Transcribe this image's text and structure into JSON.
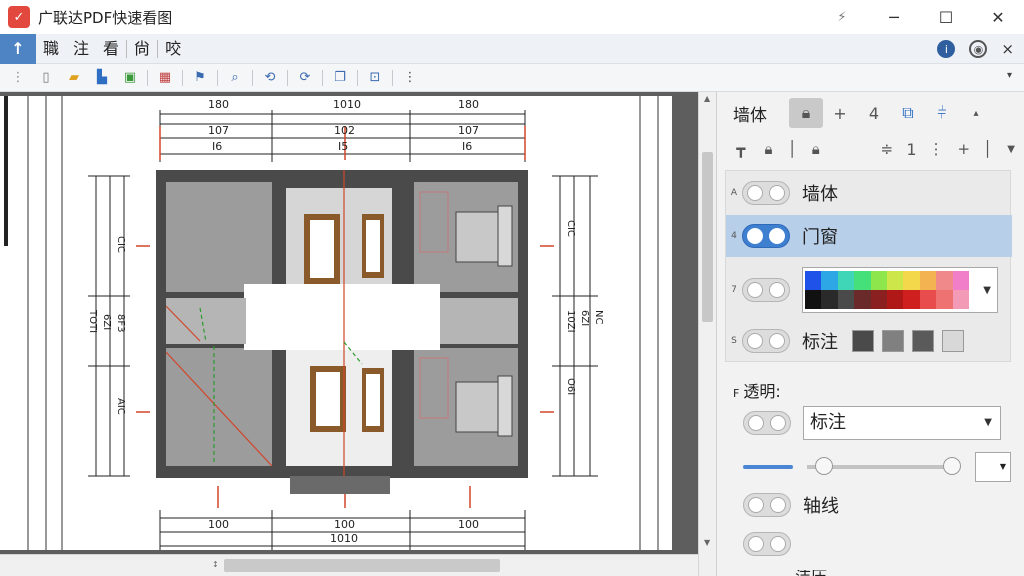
{
  "app": {
    "title": "广联达PDF快速看图",
    "logo_glyph": "✓"
  },
  "window": {
    "pin": "⚡",
    "minimize": "─",
    "maximize": "☐",
    "close": "✕"
  },
  "menu": {
    "home_glyph": "↑",
    "items": [
      "職",
      "注",
      "看",
      "尙",
      "咬"
    ],
    "right_icons": [
      "info-icon",
      "settings-icon",
      "close-icon"
    ],
    "close_glyph": "×"
  },
  "toolbar": {
    "icons": [
      "new-file-icon",
      "open-folder-icon",
      "export-icon",
      "save-icon",
      "grid-icon",
      "layer-icon",
      "measure-icon",
      "zoom-icon",
      "rotate-icon",
      "fit-icon",
      "compare-icon"
    ],
    "more": "⋮",
    "overflow": "▾"
  },
  "drawing": {
    "dim_top": [
      "180",
      "1010",
      "180"
    ],
    "dim_mid": [
      "107",
      "102",
      "107"
    ],
    "dim_small": [
      "I6",
      "I5",
      "I6"
    ],
    "dim_bottom": [
      "100",
      "100",
      "100"
    ],
    "dim_bottom2": [
      "1010"
    ],
    "dim_left": [
      "CIC",
      "TOTI",
      "6ZI",
      "8F3",
      "AIC"
    ],
    "dim_right": [
      "CIC",
      "O6I",
      "6ZI",
      "10ZI",
      "NC"
    ]
  },
  "panel": {
    "tab_label": "墙体",
    "tab_icons": [
      "lock-icon",
      "plus-icon",
      "four-icon",
      "copy-icon",
      "split-icon",
      "collapse-icon"
    ],
    "tool_num": "1",
    "layers": [
      {
        "key": "A",
        "name": "墙体",
        "on": false
      },
      {
        "key": "4",
        "name": "门窗",
        "on": true
      },
      {
        "key": "7",
        "name": "",
        "on": false
      },
      {
        "key": "S",
        "name": "标注",
        "on": false
      }
    ],
    "palette_top": [
      "#1f52e8",
      "#2ea7e6",
      "#3fd6b8",
      "#45e07a",
      "#8ce64c",
      "#cde74a",
      "#f2d84a",
      "#f3b350",
      "#f08a8a",
      "#f07ec8"
    ],
    "palette_bottom": [
      "#111111",
      "#2a2a2a",
      "#4a4a4a",
      "#6a2a2a",
      "#8a2020",
      "#b01818",
      "#d01f1f",
      "#e84c4c",
      "#ef7272",
      "#f29ab6"
    ],
    "swatches": [
      "#4a4a4a",
      "#808080",
      "#5a5a5a",
      "#d8d8d8"
    ],
    "opacity_key": "F",
    "opacity_label": "透明:",
    "opacity_select": "标注",
    "axis_label": "轴线",
    "slider_value": "",
    "cutoff_label": "洁压"
  }
}
